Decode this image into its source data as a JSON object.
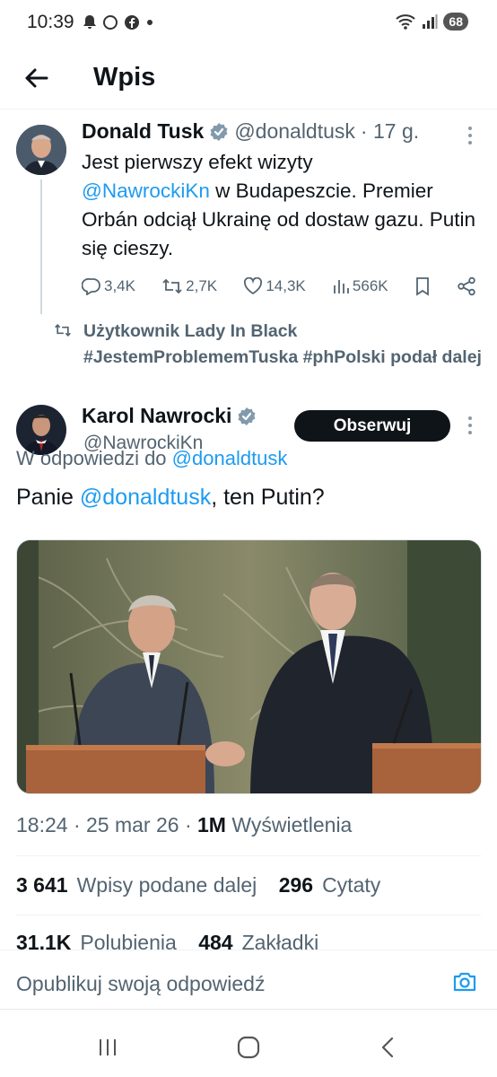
{
  "status_bar": {
    "time": "10:39",
    "battery": "68",
    "left_icons": [
      "bell-icon",
      "chat-bubble-icon",
      "facebook-icon",
      "dot-icon"
    ],
    "right_icons": [
      "wifi-icon",
      "signal-icon"
    ]
  },
  "header": {
    "title": "Wpis",
    "back_icon": "arrow-left-icon"
  },
  "tweet1": {
    "name": "Donald Tusk",
    "handle": "@donaldtusk",
    "time": "· 17 g.",
    "text_before": "Jest pierwszy efekt wizyty",
    "mention": "@NawrockiKn",
    "text_after": " w Budapeszcie. Premier Orbán odciął Ukrainę od dostaw gazu. Putin się cieszy.",
    "replies": "3,4K",
    "reposts": "2,7K",
    "likes": "14,3K",
    "views": "566K"
  },
  "repost_notice": {
    "text": "Użytkownik Lady In Black #JestemProblememTuska #phPolski podał dalej"
  },
  "tweet2": {
    "name": "Karol Nawrocki",
    "handle": "@NawrockiKn",
    "follow_label": "Obserwuj",
    "reply_prefix": "W odpowiedzi do",
    "reply_mention": "@donaldtusk",
    "text_before": "Panie ",
    "text_mention": "@donaldtusk",
    "text_after": ", ten Putin?"
  },
  "meta": {
    "time": "18:24",
    "date": "· 25 mar 26 ·",
    "views_count": "1M",
    "views_label": "Wyświetlenia"
  },
  "stats": {
    "reposts_count": "3 641",
    "reposts_label": "Wpisy podane dalej",
    "quotes_count": "296",
    "quotes_label": "Cytaty",
    "likes_count": "31,1K",
    "likes_label": "Polubienia",
    "bookmarks_count": "484",
    "bookmarks_label": "Zakładki"
  },
  "reply_bar": {
    "placeholder": "Opublikuj swoją odpowiedź"
  },
  "colors": {
    "accent": "#1d9bf0",
    "text": "#0f1419",
    "secondary": "#536471",
    "verified": "#829aab"
  }
}
